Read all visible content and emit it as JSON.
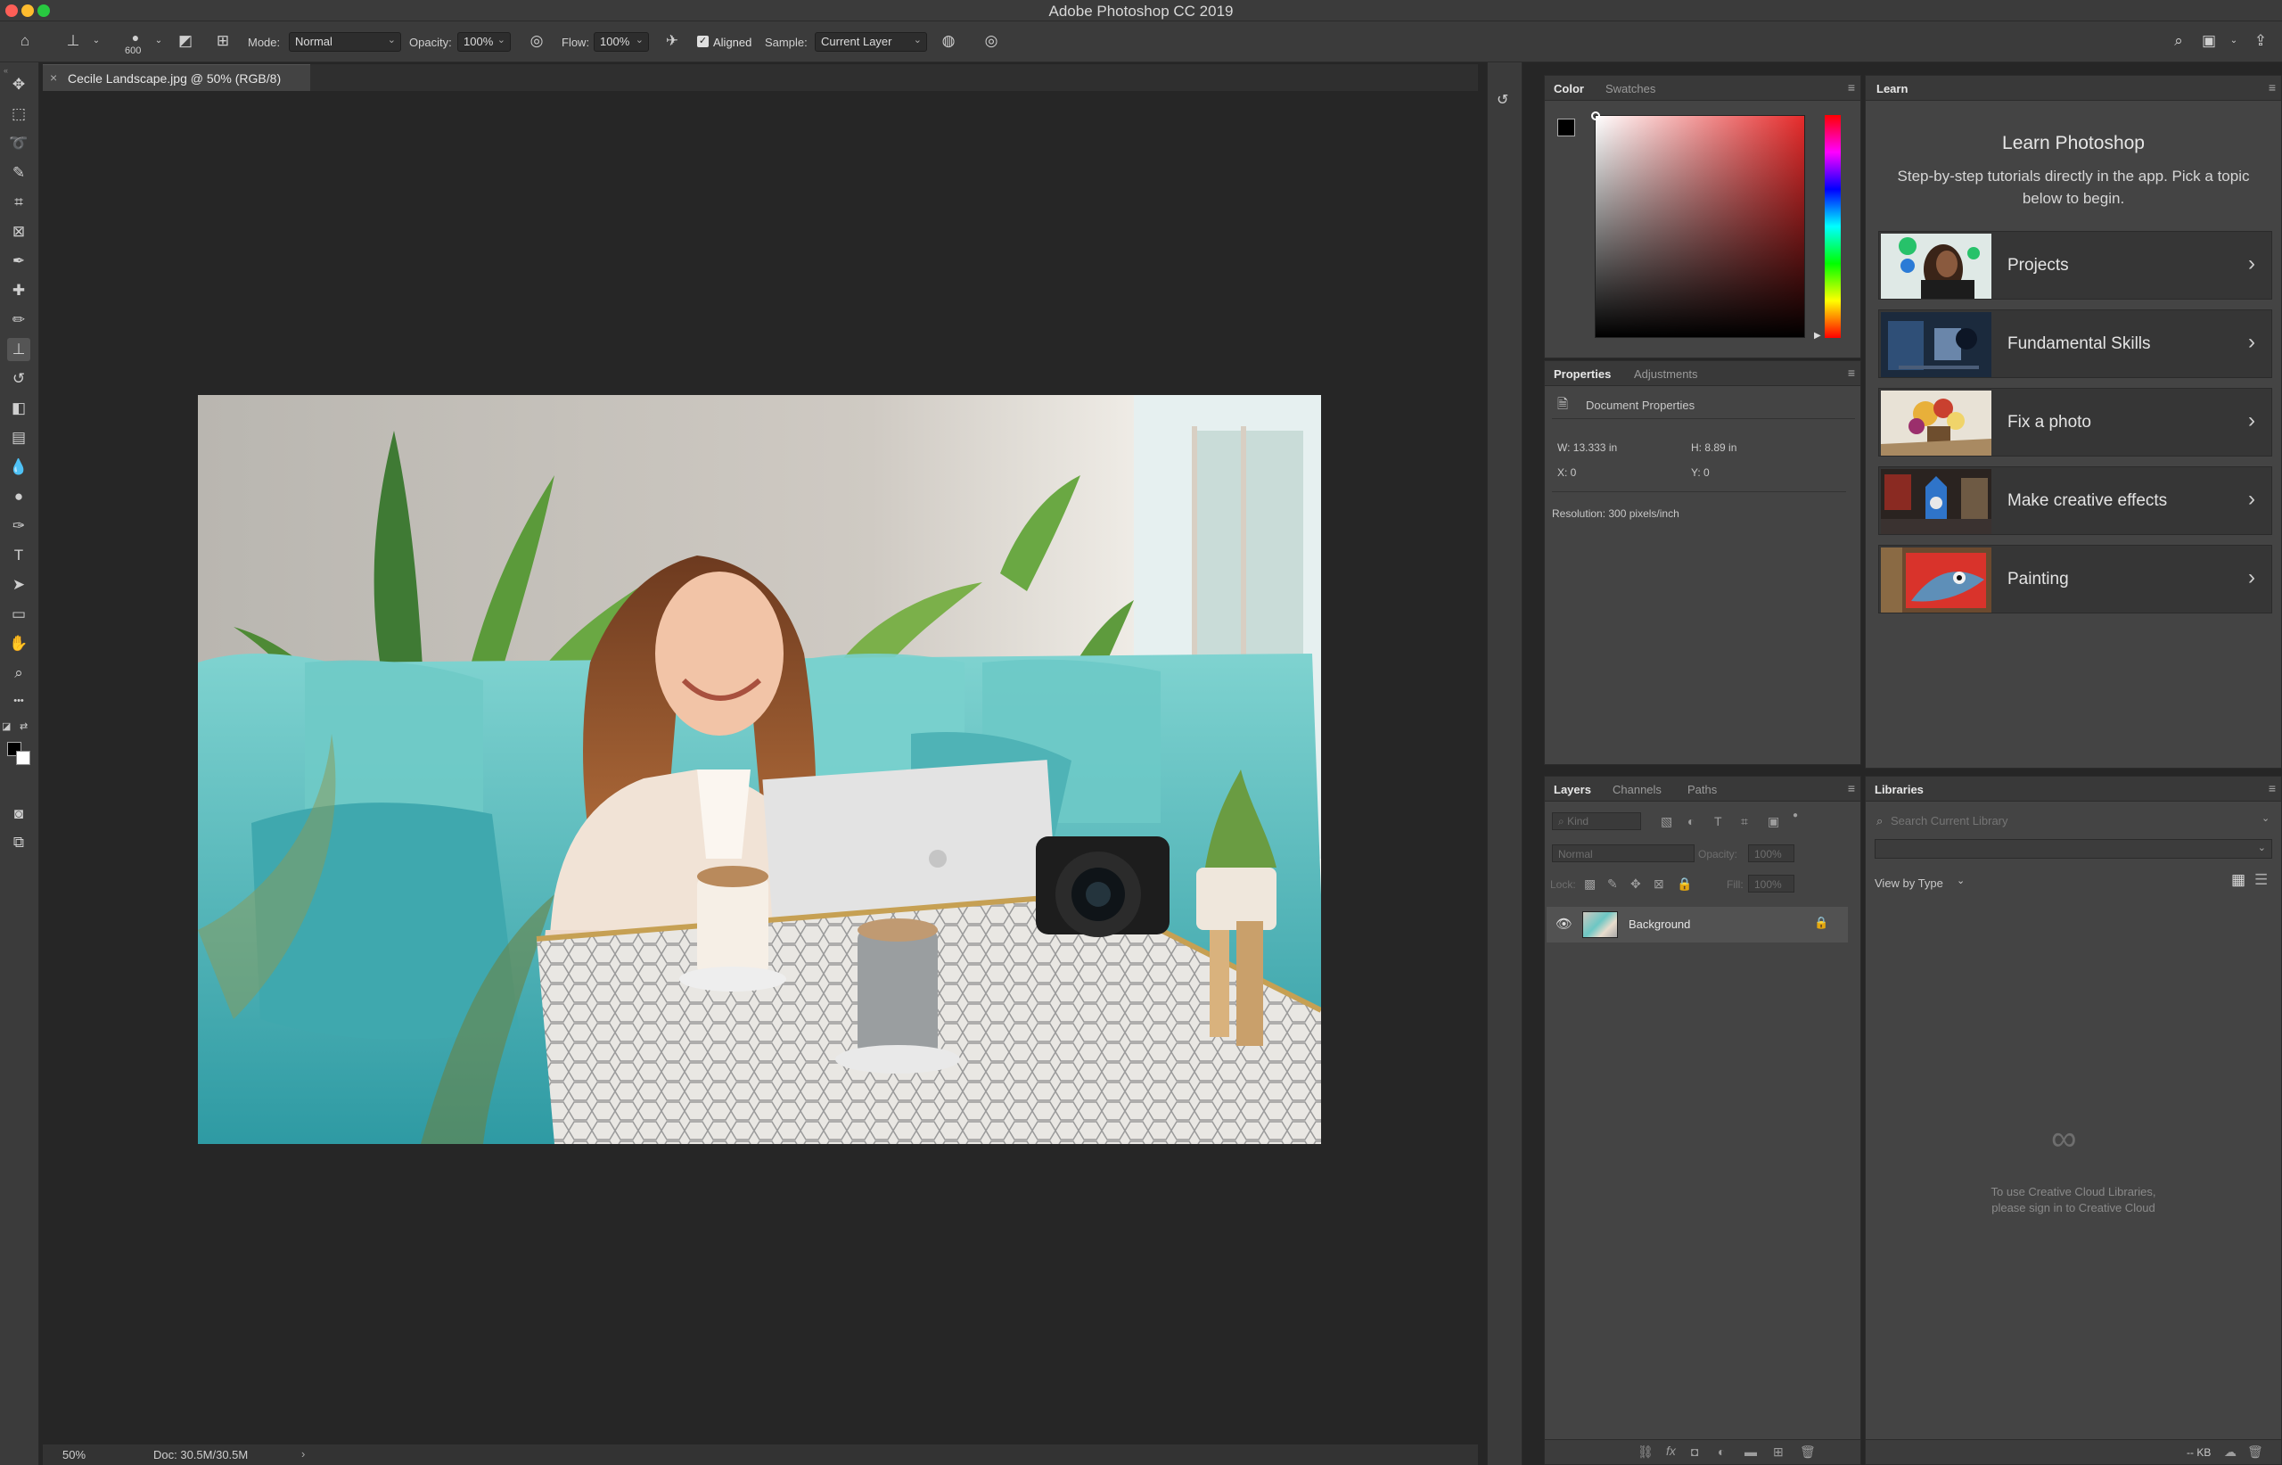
{
  "app": {
    "title": "Adobe Photoshop CC 2019"
  },
  "options_bar": {
    "brush_size": "600",
    "mode_label": "Mode:",
    "mode_value": "Normal",
    "opacity_label": "Opacity:",
    "opacity_value": "100%",
    "flow_label": "Flow:",
    "flow_value": "100%",
    "aligned_label": "Aligned",
    "aligned_checked": true,
    "sample_label": "Sample:",
    "sample_value": "Current Layer"
  },
  "document": {
    "tab_title": "Cecile Landscape.jpg @ 50% (RGB/8)",
    "zoom": "50%",
    "doc_size": "Doc: 30.5M/30.5M"
  },
  "tools": [
    {
      "name": "move-tool",
      "glyph": "✥"
    },
    {
      "name": "marquee-tool",
      "glyph": "⬚"
    },
    {
      "name": "lasso-tool",
      "glyph": "➰"
    },
    {
      "name": "quick-select-tool",
      "glyph": "✎"
    },
    {
      "name": "crop-tool",
      "glyph": "⌗"
    },
    {
      "name": "frame-tool",
      "glyph": "⊠"
    },
    {
      "name": "eyedropper-tool",
      "glyph": "✒"
    },
    {
      "name": "healing-brush-tool",
      "glyph": "✚"
    },
    {
      "name": "brush-tool",
      "glyph": "✏"
    },
    {
      "name": "clone-stamp-tool",
      "glyph": "⊥"
    },
    {
      "name": "history-brush-tool",
      "glyph": "↺"
    },
    {
      "name": "eraser-tool",
      "glyph": "◧"
    },
    {
      "name": "gradient-tool",
      "glyph": "▤"
    },
    {
      "name": "blur-tool",
      "glyph": "💧"
    },
    {
      "name": "dodge-tool",
      "glyph": "●"
    },
    {
      "name": "pen-tool",
      "glyph": "✑"
    },
    {
      "name": "type-tool",
      "glyph": "T"
    },
    {
      "name": "path-select-tool",
      "glyph": "➤"
    },
    {
      "name": "rectangle-tool",
      "glyph": "▭"
    },
    {
      "name": "hand-tool",
      "glyph": "✋"
    },
    {
      "name": "zoom-tool",
      "glyph": "⌕"
    },
    {
      "name": "more-tools",
      "glyph": "•••"
    }
  ],
  "color_panel": {
    "tab_color": "Color",
    "tab_swatches": "Swatches",
    "foreground": "#000000",
    "background": "#ffffff",
    "hue_color": "#e62b2b"
  },
  "properties_panel": {
    "tab_properties": "Properties",
    "tab_adjustments": "Adjustments",
    "section": "Document Properties",
    "width": "W: 13.333 in",
    "height": "H: 8.89 in",
    "x": "X: 0",
    "y": "Y: 0",
    "resolution": "Resolution: 300 pixels/inch"
  },
  "layers_panel": {
    "tab_layers": "Layers",
    "tab_channels": "Channels",
    "tab_paths": "Paths",
    "filter_kind": "Kind",
    "blend_mode": "Normal",
    "opacity_label": "Opacity:",
    "opacity_value": "100%",
    "lock_label": "Lock:",
    "fill_label": "Fill:",
    "fill_value": "100%",
    "layers": [
      {
        "name": "Background",
        "visible": true,
        "locked": true
      }
    ]
  },
  "learn_panel": {
    "tab": "Learn",
    "heading": "Learn Photoshop",
    "description": "Step-by-step tutorials directly in the app. Pick a topic below to begin.",
    "cards": [
      {
        "label": "Projects"
      },
      {
        "label": "Fundamental Skills"
      },
      {
        "label": "Fix a photo"
      },
      {
        "label": "Make creative effects"
      },
      {
        "label": "Painting"
      }
    ]
  },
  "libraries_panel": {
    "tab": "Libraries",
    "search_placeholder": "Search Current Library",
    "view_by": "View by Type",
    "signin_line1": "To use Creative Cloud Libraries,",
    "signin_line2": "please sign in to Creative Cloud",
    "storage": "-- KB"
  }
}
